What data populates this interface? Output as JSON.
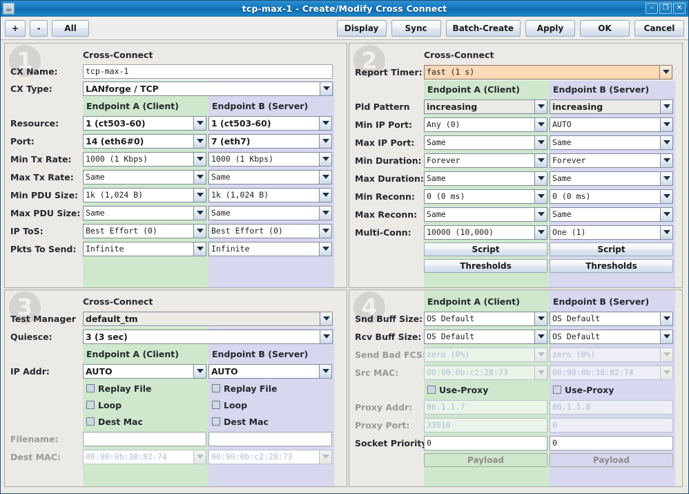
{
  "window": {
    "title": "tcp-max-1 - Create/Modify Cross Connect",
    "app_icon": "java-coffee-cup-icon",
    "minimize": "–",
    "maximize": "❐",
    "close": "✕"
  },
  "toolbar": {
    "plus": "+",
    "minus": "-",
    "all": "All",
    "display": "Display",
    "sync": "Sync",
    "batch_create": "Batch-Create",
    "apply": "Apply",
    "ok": "OK",
    "cancel": "Cancel"
  },
  "endpoint_headers": {
    "a": "Endpoint A   (Client)",
    "b": "Endpoint B   (Server)"
  },
  "panel1": {
    "number": "1",
    "group_title": "Cross-Connect",
    "cx_name_label": "CX Name:",
    "cx_name_value": "tcp-max-1",
    "cx_type_label": "CX Type:",
    "cx_type_value": "LANforge / TCP",
    "rows": [
      {
        "label": "Resource:",
        "a": "1 (ct503-60)",
        "b": "1 (ct503-60)",
        "style": "bold"
      },
      {
        "label": "Port:",
        "a": "14 (eth6#0)",
        "b": "7 (eth7)",
        "style": "bold"
      },
      {
        "label": "Min Tx Rate:",
        "a": "1000 (1 Kbps)",
        "b": "1000 (1 Kbps)",
        "style": "mono"
      },
      {
        "label": "Max Tx Rate:",
        "a": "Same",
        "b": "Same",
        "style": "mono"
      },
      {
        "label": "Min PDU Size:",
        "a": "1k      (1,024 B)",
        "b": "1k      (1,024 B)",
        "style": "mono"
      },
      {
        "label": "Max PDU Size:",
        "a": "Same",
        "b": "Same",
        "style": "mono"
      },
      {
        "label": "IP ToS:",
        "a": "Best Effort   (0)",
        "b": "Best Effort   (0)",
        "style": "mono"
      },
      {
        "label": "Pkts To Send:",
        "a": "Infinite",
        "b": "Infinite",
        "style": "mono"
      }
    ]
  },
  "panel2": {
    "number": "2",
    "group_title": "Cross-Connect",
    "report_timer_label": "Report Timer:",
    "report_timer_value": "fast    (1 s)",
    "rows": [
      {
        "label": "Pld Pattern",
        "a": "increasing",
        "b": "increasing",
        "style": "boldgray"
      },
      {
        "label": "Min IP Port:",
        "a": "Any (0)",
        "b": "AUTO",
        "style": "mono"
      },
      {
        "label": "Max IP Port:",
        "a": "Same",
        "b": "Same",
        "style": "mono"
      },
      {
        "label": "Min Duration:",
        "a": "Forever",
        "b": "Forever",
        "style": "mono"
      },
      {
        "label": "Max Duration:",
        "a": "Same",
        "b": "Same",
        "style": "mono"
      },
      {
        "label": "Min Reconn:",
        "a": "0     (0 ms)",
        "b": "0     (0 ms)",
        "style": "mono"
      },
      {
        "label": "Max Reconn:",
        "a": "Same",
        "b": "Same",
        "style": "mono"
      },
      {
        "label": "Multi-Conn:",
        "a": "10000 (10,000)",
        "b": "One (1)",
        "style": "mono"
      }
    ],
    "script_button": "Script",
    "thresholds_button": "Thresholds"
  },
  "panel3": {
    "number": "3",
    "group_title": "Cross-Connect",
    "test_manager_label": "Test Manager",
    "test_manager_value": "default_tm",
    "quiesce_label": "Quiesce:",
    "quiesce_value": "3 (3 sec)",
    "ip_addr_label": "IP Addr:",
    "ip_addr_a": "AUTO",
    "ip_addr_b": "AUTO",
    "checkboxes": [
      "Replay File",
      "Loop",
      "Dest Mac"
    ],
    "filename_label": "Filename:",
    "filename_a": "",
    "filename_b": "",
    "dest_mac_label": "Dest MAC:",
    "dest_mac_a": "00:90:0b:38:82:74",
    "dest_mac_b": "00:90:0b:c2:28:73"
  },
  "panel4": {
    "number": "4",
    "rows": [
      {
        "label": "Snd Buff Size:",
        "a": "OS Default",
        "b": "OS Default",
        "disabled": false
      },
      {
        "label": "Rcv Buff Size:",
        "a": "OS Default",
        "b": "OS Default",
        "disabled": false
      },
      {
        "label": "Send Bad FCS:",
        "a": "zero (0%)",
        "b": "zero (0%)",
        "disabled": true
      },
      {
        "label": "Src MAC:",
        "a": "00:90:0b:c2:28:73",
        "b": "00:90:0b:38:82:74",
        "disabled": true
      }
    ],
    "use_proxy_label": "Use-Proxy",
    "proxy_addr_label": "Proxy Addr:",
    "proxy_addr_a": "86.1.1.7",
    "proxy_addr_b": "86.1.1.8",
    "proxy_port_label": "Proxy Port:",
    "proxy_port_a": "33010",
    "proxy_port_b": "0",
    "socket_priority_label": "Socket Priority:",
    "socket_priority_a": "0",
    "socket_priority_b": "0",
    "payload_button": "Payload"
  },
  "colors": {
    "endpoint_a_band": "#cfe8cd",
    "endpoint_b_band": "#d7d7ef",
    "title_bar": "#1379c0",
    "report_timer_highlight": "#fbd9b6"
  }
}
